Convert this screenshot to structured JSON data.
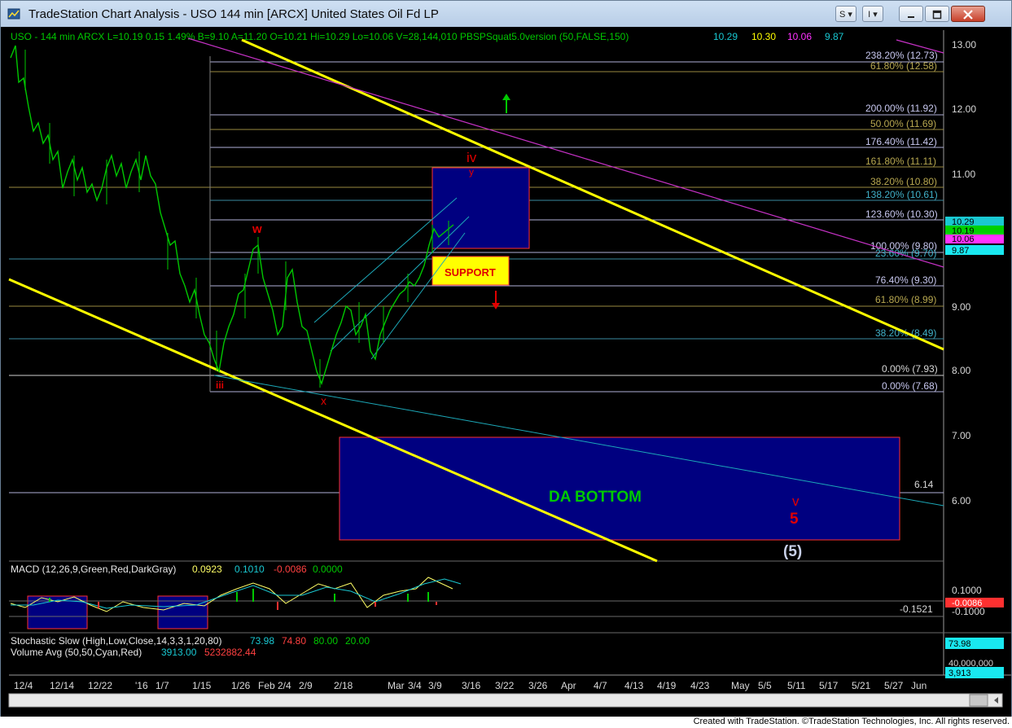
{
  "window": {
    "title": "TradeStation Chart Analysis - USO 144 min [ARCX] United States Oil Fd LP",
    "buttons": {
      "s_menu": "S",
      "i_menu": "I"
    }
  },
  "header": {
    "symbol": "USO - 144 min  ARCX  L=10.19  0.15  1.49%  B=9.10  A=11.20  O=10.21  Hi=10.29  Lo=10.06  V=28,144,010  PBSPSquat5.0version (50,FALSE,150)",
    "indicator_values": [
      "10.29",
      "10.30",
      "10.06",
      "9.87"
    ]
  },
  "price_axis": {
    "ticks": [
      "13.00",
      "12.00",
      "11.00",
      "10.00",
      "9.00",
      "8.00",
      "7.00",
      "6.00"
    ],
    "tags": [
      "10.29",
      "10.19",
      "10.06",
      "9.87"
    ]
  },
  "fib_levels": [
    "238.20% (12.73)",
    "61.80% (12.58)",
    "200.00% (11.92)",
    "50.00% (11.69)",
    "176.40% (11.42)",
    "161.80% (11.11)",
    "38.20% (10.80)",
    "138.20% (10.61)",
    "123.60% (10.30)",
    "100.00% (9.80)",
    "23.60% (9.70)",
    "76.40% (9.30)",
    "61.80% (8.99)",
    "38.20% (8.49)",
    "0.00% (7.93)",
    "0.00% (7.68)",
    "6.14"
  ],
  "annotations": {
    "w": "w",
    "iii": "iii",
    "x": "x",
    "iv": "iv",
    "y": "y",
    "support": "SUPPORT",
    "da_bottom": "DA BOTTOM",
    "v": "v",
    "five": "5",
    "five_paren": "(5)"
  },
  "macd": {
    "label": "MACD (12,26,9,Green,Red,DarkGray)",
    "values": [
      "0.0923",
      "0.1010",
      "-0.0086",
      "0.0000"
    ],
    "axis": [
      "0.1000",
      "-0.0086",
      "-0.1000"
    ],
    "level": "-0.1521"
  },
  "stochastic": {
    "label": "Stochastic Slow (High,Low,Close,14,3,3,1,20,80)",
    "values": [
      "73.98",
      "74.80",
      "80.00",
      "20.00"
    ],
    "axis": "73.98"
  },
  "volume": {
    "label": "Volume Avg (50,50,Cyan,Red)",
    "values": [
      "3913.00",
      "5232882.44"
    ],
    "axis": [
      "40,000,000",
      "3,913"
    ]
  },
  "date_axis": [
    "12/4",
    "12/14",
    "12/22",
    "'16",
    "1/7",
    "1/15",
    "1/26",
    "Feb",
    "2/4",
    "2/9",
    "2/18",
    "Mar",
    "3/4",
    "3/9",
    "3/16",
    "3/22",
    "3/26",
    "Apr",
    "4/7",
    "4/13",
    "4/19",
    "4/23",
    "May",
    "5/5",
    "5/11",
    "5/17",
    "5/21",
    "5/27",
    "Jun"
  ],
  "footer": "Created with TradeStation. ©TradeStation Technologies, Inc. All rights reserved.",
  "colors": {
    "background": "#000000",
    "price_bars": "#00c800",
    "yellow_trend": "#ffff00",
    "magenta_trend": "#c832c8",
    "cyan_trend": "#1ca8b8",
    "box_fill": "#000080",
    "box_border": "#ff3030",
    "wave_labels": "#e00000",
    "da_bottom_text": "#00c800"
  }
}
